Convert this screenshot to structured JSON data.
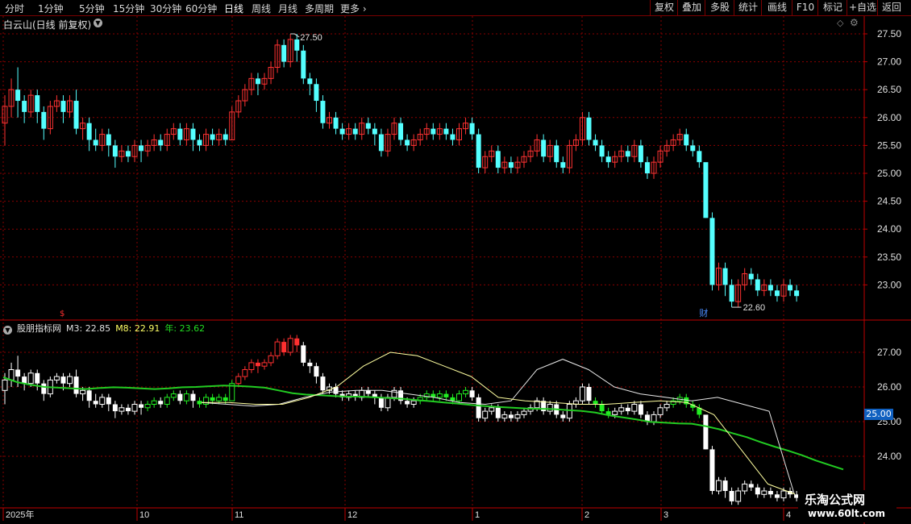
{
  "toolbar": {
    "tabs": [
      "分时",
      "1分钟",
      "5分钟",
      "15分钟",
      "30分钟",
      "60分钟",
      "日线",
      "周线",
      "月线",
      "多周期",
      "更多"
    ],
    "active_tab": "日线",
    "right_buttons": [
      "复权",
      "叠加",
      "多股",
      "统计",
      "画线",
      "F10",
      "标记",
      "+自选",
      "返回"
    ]
  },
  "stock": {
    "title": "白云山(日线 前复权)"
  },
  "indicator": {
    "name": "股朋指标网",
    "m3_label": "M3: 22.85",
    "m8_label": "M8: 22.91",
    "year_label": "年: 23.62"
  },
  "annotations": {
    "high_label": "27.50",
    "low_label": "22.60",
    "fin_marker": "财",
    "price_tag": "25.00"
  },
  "colors": {
    "up": "#ff3232",
    "down": "#54ffff",
    "ma_year": "#22cc22",
    "ma_short": "#ffffa0",
    "grid": "#8a0000"
  },
  "watermark": {
    "line1": "乐淘公式网",
    "line2": "www.60lt.com"
  },
  "chart_data": [
    {
      "type": "candlestick",
      "title": "白云山(日线 前复权)",
      "y_ticks": [
        "27.50",
        "27.00",
        "26.50",
        "26.00",
        "25.50",
        "25.00",
        "24.50",
        "24.00",
        "23.50",
        "23.00"
      ],
      "ylim": [
        22.6,
        27.5
      ],
      "x_ticks": [
        "2025年",
        "10",
        "11",
        "12",
        "1",
        "2",
        "3",
        "4"
      ],
      "series": [
        {
          "values": [
            [
              25.9,
              26.2,
              25.5,
              26.4
            ],
            [
              26.2,
              26.5,
              26.0,
              26.7
            ],
            [
              26.5,
              26.3,
              26.0,
              26.9
            ],
            [
              26.3,
              26.1,
              25.9,
              26.4
            ],
            [
              26.1,
              26.4,
              26.0,
              26.5
            ],
            [
              26.4,
              26.1,
              25.9,
              26.5
            ],
            [
              26.1,
              25.8,
              25.6,
              26.2
            ],
            [
              25.8,
              26.2,
              25.7,
              26.3
            ],
            [
              26.2,
              26.3,
              26.1,
              26.4
            ],
            [
              26.3,
              26.1,
              25.9,
              26.4
            ],
            [
              26.1,
              26.3,
              26.0,
              26.4
            ],
            [
              26.3,
              25.8,
              25.7,
              26.5
            ],
            [
              25.8,
              25.9,
              25.6,
              26.0
            ],
            [
              25.9,
              25.6,
              25.4,
              26.0
            ],
            [
              25.6,
              25.5,
              25.4,
              25.8
            ],
            [
              25.5,
              25.7,
              25.4,
              25.8
            ],
            [
              25.7,
              25.5,
              25.3,
              25.8
            ],
            [
              25.5,
              25.3,
              25.1,
              25.6
            ],
            [
              25.3,
              25.4,
              25.2,
              25.5
            ],
            [
              25.4,
              25.3,
              25.2,
              25.5
            ],
            [
              25.3,
              25.5,
              25.2,
              25.6
            ],
            [
              25.5,
              25.4,
              25.2,
              25.6
            ],
            [
              25.4,
              25.5,
              25.3,
              25.6
            ],
            [
              25.5,
              25.6,
              25.4,
              25.7
            ],
            [
              25.6,
              25.5,
              25.4,
              25.7
            ],
            [
              25.5,
              25.7,
              25.4,
              25.8
            ],
            [
              25.7,
              25.8,
              25.6,
              25.9
            ],
            [
              25.8,
              25.6,
              25.5,
              25.9
            ],
            [
              25.6,
              25.8,
              25.5,
              25.9
            ],
            [
              25.8,
              25.6,
              25.4,
              25.9
            ],
            [
              25.6,
              25.5,
              25.4,
              25.7
            ],
            [
              25.5,
              25.7,
              25.4,
              25.8
            ],
            [
              25.7,
              25.6,
              25.5,
              25.8
            ],
            [
              25.6,
              25.7,
              25.5,
              25.8
            ],
            [
              25.7,
              25.6,
              25.5,
              25.8
            ],
            [
              25.6,
              26.1,
              25.6,
              26.2
            ],
            [
              26.1,
              26.3,
              26.0,
              26.4
            ],
            [
              26.3,
              26.5,
              26.2,
              26.6
            ],
            [
              26.5,
              26.7,
              26.4,
              26.8
            ],
            [
              26.7,
              26.6,
              26.4,
              26.8
            ],
            [
              26.6,
              26.7,
              26.5,
              26.8
            ],
            [
              26.7,
              26.9,
              26.6,
              27.0
            ],
            [
              26.9,
              27.3,
              26.8,
              27.4
            ],
            [
              27.3,
              27.0,
              26.9,
              27.4
            ],
            [
              27.0,
              27.4,
              26.9,
              27.5
            ],
            [
              27.4,
              27.2,
              27.0,
              27.5
            ],
            [
              27.2,
              26.7,
              26.6,
              27.3
            ],
            [
              26.7,
              26.6,
              26.4,
              26.8
            ],
            [
              26.6,
              26.3,
              26.1,
              26.7
            ],
            [
              26.3,
              25.9,
              25.8,
              26.4
            ],
            [
              25.9,
              26.0,
              25.8,
              26.1
            ],
            [
              26.0,
              25.8,
              25.7,
              26.1
            ],
            [
              25.8,
              25.7,
              25.6,
              25.9
            ],
            [
              25.7,
              25.8,
              25.6,
              25.9
            ],
            [
              25.8,
              25.7,
              25.6,
              25.9
            ],
            [
              25.7,
              25.9,
              25.6,
              26.0
            ],
            [
              25.9,
              25.8,
              25.7,
              26.0
            ],
            [
              25.8,
              25.7,
              25.5,
              25.9
            ],
            [
              25.7,
              25.4,
              25.3,
              25.8
            ],
            [
              25.4,
              25.7,
              25.3,
              25.8
            ],
            [
              25.7,
              25.9,
              25.6,
              26.0
            ],
            [
              25.9,
              25.6,
              25.5,
              26.0
            ],
            [
              25.6,
              25.5,
              25.4,
              25.7
            ],
            [
              25.5,
              25.6,
              25.4,
              25.7
            ],
            [
              25.6,
              25.7,
              25.5,
              25.8
            ],
            [
              25.7,
              25.8,
              25.6,
              25.9
            ],
            [
              25.8,
              25.7,
              25.6,
              25.9
            ],
            [
              25.7,
              25.8,
              25.6,
              25.9
            ],
            [
              25.8,
              25.7,
              25.6,
              25.9
            ],
            [
              25.7,
              25.6,
              25.5,
              25.8
            ],
            [
              25.6,
              25.8,
              25.5,
              25.9
            ],
            [
              25.8,
              25.9,
              25.7,
              26.0
            ],
            [
              25.9,
              25.7,
              25.6,
              26.0
            ],
            [
              25.7,
              25.1,
              25.0,
              25.8
            ],
            [
              25.1,
              25.3,
              25.0,
              25.4
            ],
            [
              25.3,
              25.4,
              25.2,
              25.5
            ],
            [
              25.4,
              25.1,
              25.0,
              25.5
            ],
            [
              25.1,
              25.2,
              25.0,
              25.3
            ],
            [
              25.2,
              25.1,
              25.0,
              25.3
            ],
            [
              25.1,
              25.2,
              25.0,
              25.3
            ],
            [
              25.2,
              25.3,
              25.1,
              25.4
            ],
            [
              25.3,
              25.4,
              25.2,
              25.5
            ],
            [
              25.4,
              25.6,
              25.3,
              25.7
            ],
            [
              25.6,
              25.3,
              25.2,
              25.7
            ],
            [
              25.3,
              25.5,
              25.2,
              25.6
            ],
            [
              25.5,
              25.2,
              25.1,
              25.6
            ],
            [
              25.2,
              25.1,
              25.0,
              25.3
            ],
            [
              25.1,
              25.5,
              25.0,
              25.6
            ],
            [
              25.5,
              25.6,
              25.4,
              25.7
            ],
            [
              25.6,
              26.0,
              25.5,
              26.1
            ],
            [
              26.0,
              25.6,
              25.5,
              26.1
            ],
            [
              25.6,
              25.5,
              25.4,
              25.7
            ],
            [
              25.5,
              25.3,
              25.2,
              25.6
            ],
            [
              25.3,
              25.2,
              25.1,
              25.4
            ],
            [
              25.2,
              25.3,
              25.1,
              25.4
            ],
            [
              25.3,
              25.4,
              25.2,
              25.5
            ],
            [
              25.4,
              25.3,
              25.2,
              25.5
            ],
            [
              25.3,
              25.5,
              25.2,
              25.6
            ],
            [
              25.5,
              25.2,
              25.1,
              25.6
            ],
            [
              25.2,
              25.0,
              24.9,
              25.3
            ],
            [
              25.0,
              25.2,
              24.9,
              25.3
            ],
            [
              25.2,
              25.4,
              25.1,
              25.5
            ],
            [
              25.4,
              25.5,
              25.3,
              25.6
            ],
            [
              25.5,
              25.6,
              25.4,
              25.7
            ],
            [
              25.6,
              25.7,
              25.5,
              25.8
            ],
            [
              25.7,
              25.5,
              25.4,
              25.8
            ],
            [
              25.5,
              25.4,
              25.3,
              25.6
            ],
            [
              25.4,
              25.2,
              25.1,
              25.5
            ],
            [
              25.2,
              24.2,
              24.2,
              24.3
            ],
            [
              24.2,
              23.0,
              22.9,
              24.3
            ],
            [
              23.0,
              23.3,
              22.9,
              23.4
            ],
            [
              23.3,
              23.0,
              22.8,
              23.4
            ],
            [
              23.0,
              22.7,
              22.6,
              23.1
            ],
            [
              22.7,
              23.0,
              22.6,
              23.1
            ],
            [
              23.0,
              23.2,
              22.9,
              23.3
            ],
            [
              23.2,
              23.1,
              23.0,
              23.3
            ],
            [
              23.1,
              22.9,
              22.8,
              23.2
            ],
            [
              22.9,
              23.0,
              22.8,
              23.1
            ],
            [
              23.0,
              22.9,
              22.8,
              23.1
            ],
            [
              22.9,
              22.8,
              22.7,
              23.0
            ],
            [
              22.8,
              23.0,
              22.7,
              23.1
            ],
            [
              23.0,
              22.9,
              22.8,
              23.1
            ],
            [
              22.9,
              22.8,
              22.7,
              23.0
            ]
          ]
        }
      ]
    },
    {
      "type": "line",
      "title": "股朋指标网",
      "y_ticks": [
        "27.00",
        "26.00",
        "25.00",
        "24.00"
      ],
      "ylim": [
        23.0,
        27.6
      ],
      "series": [
        {
          "name": "年",
          "values": [
            26.28,
            26.14,
            26.06,
            26.0,
            25.98,
            25.96,
            25.94,
            25.97,
            25.99,
            25.98,
            25.96,
            25.94,
            25.96,
            25.99,
            26.0,
            26.02,
            26.04,
            26.03,
            26.01,
            25.98,
            25.9,
            25.82,
            25.78,
            25.76,
            25.74,
            25.72,
            25.72,
            25.7,
            25.68,
            25.66,
            25.62,
            25.59,
            25.55,
            25.52,
            25.48,
            25.45,
            25.42,
            25.4,
            25.38,
            25.37,
            25.36,
            25.33,
            25.31,
            25.26,
            25.18,
            25.12,
            25.06,
            24.99,
            24.97,
            24.95,
            24.94,
            24.87,
            24.78,
            24.66,
            24.55,
            24.41,
            24.28,
            24.16,
            24.03,
            23.88,
            23.75,
            23.62
          ]
        },
        {
          "name": "M3",
          "values": [
            25.55,
            25.5,
            25.45,
            25.5,
            25.7,
            25.85,
            25.9,
            25.9,
            25.8,
            25.7,
            25.55,
            25.5,
            25.6,
            26.5,
            26.8,
            26.5,
            26.0,
            25.8,
            25.7,
            25.6,
            25.7,
            25.5,
            25.3,
            22.85
          ]
        },
        {
          "name": "M8",
          "values": [
            25.55,
            25.55,
            25.5,
            25.5,
            25.7,
            26.0,
            26.6,
            27.0,
            26.9,
            26.6,
            26.3,
            25.7,
            25.6,
            25.55,
            25.5,
            25.5,
            25.55,
            25.6,
            25.55,
            25.2,
            24.2,
            23.2,
            22.91
          ]
        }
      ]
    }
  ]
}
